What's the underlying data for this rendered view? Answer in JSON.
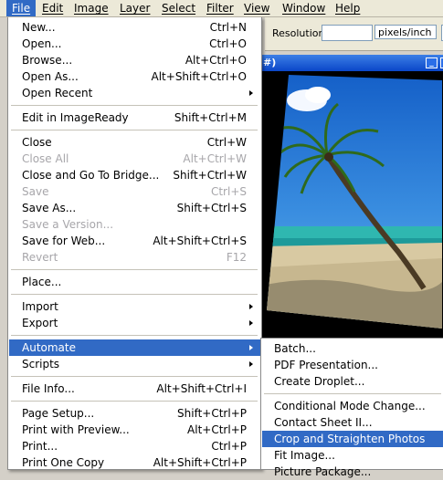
{
  "menubar": {
    "items": [
      "File",
      "Edit",
      "Image",
      "Layer",
      "Select",
      "Filter",
      "View",
      "Window",
      "Help"
    ]
  },
  "options": {
    "resolution_label": "Resolution:",
    "resolution_value": "",
    "unit_value": "pixels/inch"
  },
  "document": {
    "title_fragment": "#)"
  },
  "file_menu": {
    "new": {
      "label": "New...",
      "shortcut": "Ctrl+N"
    },
    "open": {
      "label": "Open...",
      "shortcut": "Ctrl+O"
    },
    "browse": {
      "label": "Browse...",
      "shortcut": "Alt+Ctrl+O"
    },
    "open_as": {
      "label": "Open As...",
      "shortcut": "Alt+Shift+Ctrl+O"
    },
    "open_recent": {
      "label": "Open Recent",
      "shortcut": ""
    },
    "edit_imageready": {
      "label": "Edit in ImageReady",
      "shortcut": "Shift+Ctrl+M"
    },
    "close": {
      "label": "Close",
      "shortcut": "Ctrl+W"
    },
    "close_all": {
      "label": "Close All",
      "shortcut": "Alt+Ctrl+W"
    },
    "close_bridge": {
      "label": "Close and Go To Bridge...",
      "shortcut": "Shift+Ctrl+W"
    },
    "save": {
      "label": "Save",
      "shortcut": "Ctrl+S"
    },
    "save_as": {
      "label": "Save As...",
      "shortcut": "Shift+Ctrl+S"
    },
    "save_version": {
      "label": "Save a Version...",
      "shortcut": ""
    },
    "save_web": {
      "label": "Save for Web...",
      "shortcut": "Alt+Shift+Ctrl+S"
    },
    "revert": {
      "label": "Revert",
      "shortcut": "F12"
    },
    "place": {
      "label": "Place...",
      "shortcut": ""
    },
    "import": {
      "label": "Import",
      "shortcut": ""
    },
    "export": {
      "label": "Export",
      "shortcut": ""
    },
    "automate": {
      "label": "Automate",
      "shortcut": ""
    },
    "scripts": {
      "label": "Scripts",
      "shortcut": ""
    },
    "file_info": {
      "label": "File Info...",
      "shortcut": "Alt+Shift+Ctrl+I"
    },
    "page_setup": {
      "label": "Page Setup...",
      "shortcut": "Shift+Ctrl+P"
    },
    "print_preview": {
      "label": "Print with Preview...",
      "shortcut": "Alt+Ctrl+P"
    },
    "print": {
      "label": "Print...",
      "shortcut": "Ctrl+P"
    },
    "print_one": {
      "label": "Print One Copy",
      "shortcut": "Alt+Shift+Ctrl+P"
    }
  },
  "automate_menu": {
    "batch": "Batch...",
    "pdf_presentation": "PDF Presentation...",
    "create_droplet": "Create Droplet...",
    "conditional_mode": "Conditional Mode Change...",
    "contact_sheet": "Contact Sheet II...",
    "crop_straighten": "Crop and Straighten Photos",
    "fit_image": "Fit Image...",
    "picture_package": "Picture Package..."
  },
  "colors": {
    "highlight": "#316ac5",
    "menu_bg": "#ffffff",
    "disabled_text": "#a7a6aa",
    "titlebar": "#0a46c8"
  }
}
